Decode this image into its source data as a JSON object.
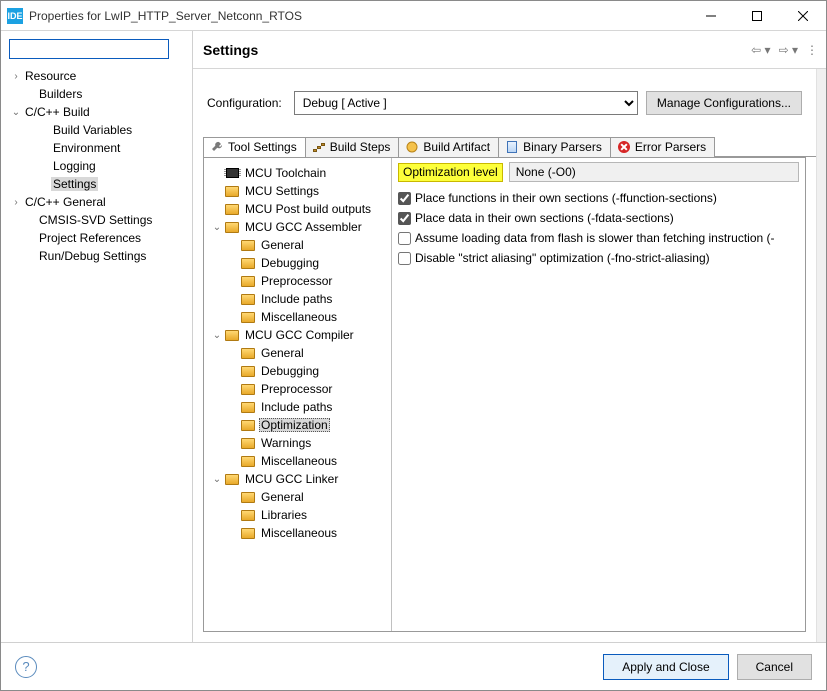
{
  "titlebar": {
    "title": "Properties for LwIP_HTTP_Server_Netconn_RTOS",
    "app_icon_label": "IDE"
  },
  "left_tree": {
    "items": [
      {
        "label": "Resource",
        "twisty": ">",
        "indent": 0,
        "selected": false
      },
      {
        "label": "Builders",
        "twisty": "",
        "indent": 1,
        "selected": false
      },
      {
        "label": "C/C++ Build",
        "twisty": "v",
        "indent": 0,
        "selected": false
      },
      {
        "label": "Build Variables",
        "twisty": "",
        "indent": 2,
        "selected": false
      },
      {
        "label": "Environment",
        "twisty": "",
        "indent": 2,
        "selected": false
      },
      {
        "label": "Logging",
        "twisty": "",
        "indent": 2,
        "selected": false
      },
      {
        "label": "Settings",
        "twisty": "",
        "indent": 2,
        "selected": true
      },
      {
        "label": "C/C++ General",
        "twisty": ">",
        "indent": 0,
        "selected": false
      },
      {
        "label": "CMSIS-SVD Settings",
        "twisty": "",
        "indent": 1,
        "selected": false
      },
      {
        "label": "Project References",
        "twisty": "",
        "indent": 1,
        "selected": false
      },
      {
        "label": "Run/Debug Settings",
        "twisty": "",
        "indent": 1,
        "selected": false
      }
    ]
  },
  "header": {
    "title": "Settings"
  },
  "config": {
    "label": "Configuration:",
    "value": "Debug  [ Active ]",
    "manage_label": "Manage Configurations..."
  },
  "tabs": [
    {
      "label": "Tool Settings",
      "active": true,
      "icon": "wrench"
    },
    {
      "label": "Build Steps",
      "active": false,
      "icon": "stairs"
    },
    {
      "label": "Build Artifact",
      "active": false,
      "icon": "artifact"
    },
    {
      "label": "Binary Parsers",
      "active": false,
      "icon": "binary"
    },
    {
      "label": "Error Parsers",
      "active": false,
      "icon": "error"
    }
  ],
  "tool_tree": [
    {
      "label": "MCU Toolchain",
      "twisty": "",
      "depth": 1,
      "icon": "chip",
      "selected": false
    },
    {
      "label": "MCU Settings",
      "twisty": "",
      "depth": 1,
      "icon": "folder",
      "selected": false
    },
    {
      "label": "MCU Post build outputs",
      "twisty": "",
      "depth": 1,
      "icon": "folder",
      "selected": false
    },
    {
      "label": "MCU GCC Assembler",
      "twisty": "v",
      "depth": 1,
      "icon": "folder",
      "selected": false
    },
    {
      "label": "General",
      "twisty": "",
      "depth": 2,
      "icon": "folder",
      "selected": false
    },
    {
      "label": "Debugging",
      "twisty": "",
      "depth": 2,
      "icon": "folder",
      "selected": false
    },
    {
      "label": "Preprocessor",
      "twisty": "",
      "depth": 2,
      "icon": "folder",
      "selected": false
    },
    {
      "label": "Include paths",
      "twisty": "",
      "depth": 2,
      "icon": "folder",
      "selected": false
    },
    {
      "label": "Miscellaneous",
      "twisty": "",
      "depth": 2,
      "icon": "folder",
      "selected": false
    },
    {
      "label": "MCU GCC Compiler",
      "twisty": "v",
      "depth": 1,
      "icon": "folder",
      "selected": false
    },
    {
      "label": "General",
      "twisty": "",
      "depth": 2,
      "icon": "folder",
      "selected": false
    },
    {
      "label": "Debugging",
      "twisty": "",
      "depth": 2,
      "icon": "folder",
      "selected": false
    },
    {
      "label": "Preprocessor",
      "twisty": "",
      "depth": 2,
      "icon": "folder",
      "selected": false
    },
    {
      "label": "Include paths",
      "twisty": "",
      "depth": 2,
      "icon": "folder",
      "selected": false
    },
    {
      "label": "Optimization",
      "twisty": "",
      "depth": 2,
      "icon": "folder",
      "selected": true
    },
    {
      "label": "Warnings",
      "twisty": "",
      "depth": 2,
      "icon": "folder",
      "selected": false
    },
    {
      "label": "Miscellaneous",
      "twisty": "",
      "depth": 2,
      "icon": "folder",
      "selected": false
    },
    {
      "label": "MCU GCC Linker",
      "twisty": "v",
      "depth": 1,
      "icon": "folder",
      "selected": false
    },
    {
      "label": "General",
      "twisty": "",
      "depth": 2,
      "icon": "folder",
      "selected": false
    },
    {
      "label": "Libraries",
      "twisty": "",
      "depth": 2,
      "icon": "folder",
      "selected": false
    },
    {
      "label": "Miscellaneous",
      "twisty": "",
      "depth": 2,
      "icon": "folder",
      "selected": false
    }
  ],
  "options": {
    "level_label": "Optimization level",
    "level_value": "None (-O0)",
    "checkboxes": [
      {
        "label": "Place functions in their own sections (-ffunction-sections)",
        "checked": true
      },
      {
        "label": "Place data in their own sections (-fdata-sections)",
        "checked": true
      },
      {
        "label": "Assume loading data from flash is slower than fetching instruction (-",
        "checked": false
      },
      {
        "label": "Disable \"strict aliasing\" optimization (-fno-strict-aliasing)",
        "checked": false
      }
    ]
  },
  "footer": {
    "apply_label": "Apply and Close",
    "cancel_label": "Cancel"
  }
}
